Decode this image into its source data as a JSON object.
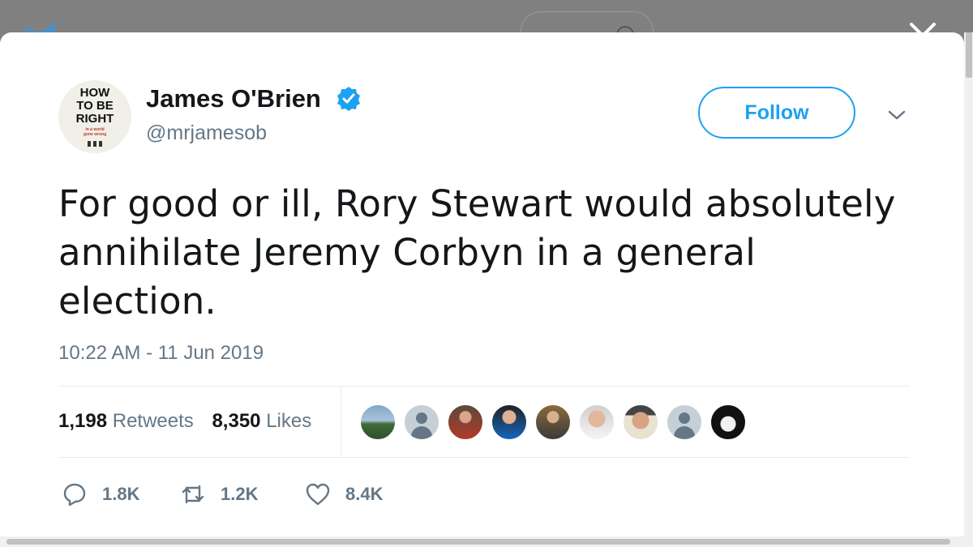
{
  "tweet": {
    "author": {
      "name": "James O'Brien",
      "handle": "@mrjamesob",
      "verified": true,
      "avatar_text": [
        "HOW",
        "TO BE",
        "RIGHT"
      ],
      "avatar_subtext": [
        "in a world",
        "gone wrong"
      ]
    },
    "follow_label": "Follow",
    "text_lines": [
      "For good or ill, Rory Stewart would absolutely",
      "annihilate Jeremy Corbyn in a general",
      "election."
    ],
    "timestamp": "10:22 AM - 11 Jun 2019",
    "stats": {
      "retweets_count": "1,198",
      "retweets_label": "Retweets",
      "likes_count": "8,350",
      "likes_label": "Likes"
    },
    "actions": {
      "reply_count": "1.8K",
      "retweet_count": "1.2K",
      "like_count": "8.4K"
    }
  },
  "colors": {
    "accent": "#1da1f2",
    "secondary_text": "#657786",
    "primary_text": "#14171a",
    "overlay": "#7b7b7b"
  },
  "icons": [
    "twitter-bird-icon",
    "close-icon",
    "verified-badge-icon",
    "chevron-down-icon",
    "reply-icon",
    "retweet-icon",
    "like-icon"
  ]
}
